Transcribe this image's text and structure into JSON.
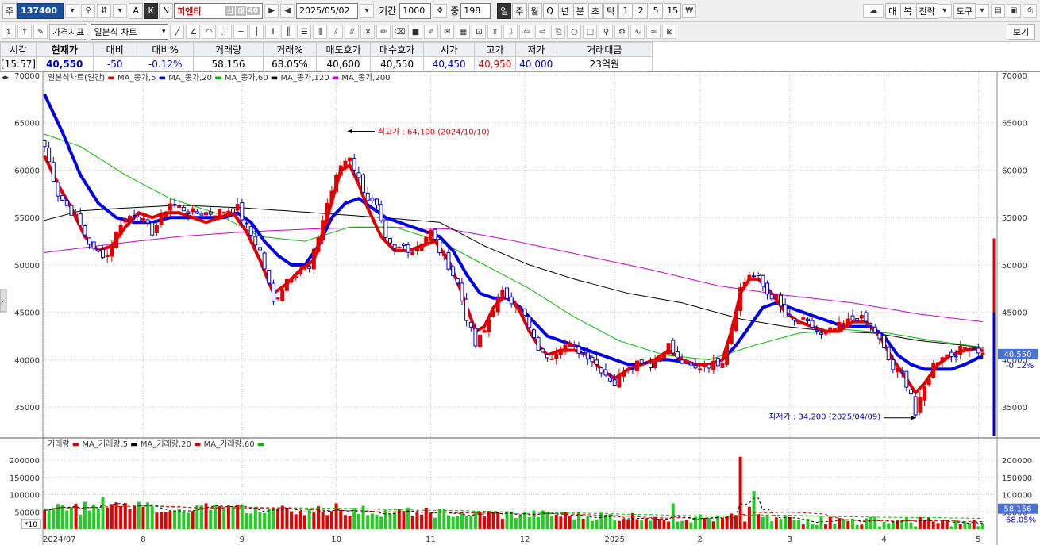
{
  "toolbar1": {
    "market": "주",
    "code": "137400",
    "stock_name": "피엔티",
    "flags": [
      "신",
      "대",
      "40"
    ],
    "date": "2025/05/02",
    "period_label": "기간",
    "period_value": "1000",
    "count_label": "중",
    "count_value": "198",
    "timeframes": [
      "일",
      "주",
      "월",
      "Q",
      "년",
      "분",
      "초",
      "틱",
      "1",
      "2",
      "5",
      "15"
    ],
    "ab_labels": [
      "A",
      "K",
      "N"
    ],
    "right_buttons": [
      "매",
      "복",
      "전략",
      "도구"
    ]
  },
  "toolbar2": {
    "indicator_btn": "가격지표",
    "chart_type": "일본식 차트",
    "view_btn": "보기"
  },
  "quote": {
    "headers": [
      "시각",
      "현재가",
      "대비",
      "대비%",
      "거래량",
      "거래%",
      "매도호가",
      "매수호가",
      "시가",
      "고가",
      "저가",
      "거래대금"
    ],
    "values": [
      "[15:57]",
      "40,550",
      "-50",
      "-0.12%",
      "58,156",
      "68.05%",
      "40,600",
      "40,550",
      "40,450",
      "40,950",
      "40,000",
      "23억원"
    ]
  },
  "chart_data": {
    "type": "candlestick",
    "legend_price": [
      "일본식차트(일간)",
      "MA_종가,5",
      "MA_종가,20",
      "MA_종가,60",
      "MA_종가,120",
      "MA_종가,200"
    ],
    "legend_volume": [
      "거래량",
      "MA_거래량,5",
      "MA_거래량,20",
      "MA_거래량,60"
    ],
    "price_ylim": [
      32000,
      70000
    ],
    "price_ticks": [
      35000,
      40000,
      45000,
      50000,
      55000,
      60000,
      65000,
      70000
    ],
    "volume_ylim": [
      0,
      230000
    ],
    "volume_ticks": [
      50000,
      100000,
      150000,
      200000
    ],
    "x_labels": [
      "2024/07",
      "8",
      "9",
      "10",
      "11",
      "12",
      "2025",
      "2",
      "3",
      "4",
      "5"
    ],
    "x_label_index": [
      0,
      22,
      44,
      65,
      86,
      107,
      127,
      146,
      166,
      187,
      208
    ],
    "high_annotation": "최고가 : 64,100 (2024/10/10)",
    "low_annotation": "최저가 : 34,200 (2025/04/09)",
    "current_price": "40,550",
    "current_change": "-0.12%",
    "current_volume": "58,156",
    "volume_pct": "68.05%",
    "volume_unit": "*10",
    "series_colors": {
      "ma5": "#e00000",
      "ma20": "#0000e0",
      "ma60": "#00bb00",
      "ma120": "#000000",
      "ma200": "#d000d0",
      "up": "#e00000",
      "down": "#0000c8",
      "vol_up": "#e00000",
      "vol_down": "#22cc22"
    },
    "close_anchors": [
      [
        0,
        62500
      ],
      [
        3,
        57500
      ],
      [
        7,
        55000
      ],
      [
        11,
        51500
      ],
      [
        14,
        51000
      ],
      [
        17,
        54500
      ],
      [
        20,
        55500
      ],
      [
        24,
        53500
      ],
      [
        28,
        56500
      ],
      [
        33,
        55500
      ],
      [
        38,
        55500
      ],
      [
        43,
        56000
      ],
      [
        45,
        54000
      ],
      [
        48,
        51500
      ],
      [
        51,
        46000
      ],
      [
        54,
        48500
      ],
      [
        57,
        49500
      ],
      [
        59,
        49500
      ],
      [
        61,
        53000
      ],
      [
        63,
        56500
      ],
      [
        66,
        60500
      ],
      [
        68,
        61500
      ],
      [
        70,
        59000
      ],
      [
        72,
        57000
      ],
      [
        74,
        56000
      ],
      [
        76,
        52500
      ],
      [
        78,
        51500
      ],
      [
        80,
        52000
      ],
      [
        82,
        51500
      ],
      [
        84,
        52500
      ],
      [
        86,
        53500
      ],
      [
        88,
        51500
      ],
      [
        90,
        50000
      ],
      [
        92,
        48000
      ],
      [
        94,
        44500
      ],
      [
        96,
        41500
      ],
      [
        98,
        43000
      ],
      [
        100,
        45500
      ],
      [
        102,
        47000
      ],
      [
        105,
        46000
      ],
      [
        107,
        44500
      ],
      [
        109,
        42000
      ],
      [
        111,
        40500
      ],
      [
        113,
        40500
      ],
      [
        115,
        41500
      ],
      [
        117,
        41500
      ],
      [
        119,
        41000
      ],
      [
        121,
        40500
      ],
      [
        123,
        39500
      ],
      [
        125,
        38500
      ],
      [
        127,
        37500
      ],
      [
        129,
        39000
      ],
      [
        131,
        39500
      ],
      [
        133,
        40000
      ],
      [
        135,
        39500
      ],
      [
        137,
        40500
      ],
      [
        139,
        41500
      ],
      [
        141,
        40000
      ],
      [
        143,
        39500
      ],
      [
        145,
        39000
      ],
      [
        147,
        39500
      ],
      [
        149,
        39500
      ],
      [
        151,
        40000
      ],
      [
        153,
        43500
      ],
      [
        155,
        47500
      ],
      [
        157,
        49000
      ],
      [
        159,
        48500
      ],
      [
        161,
        47000
      ],
      [
        163,
        46500
      ],
      [
        165,
        44500
      ],
      [
        167,
        44000
      ],
      [
        169,
        44000
      ],
      [
        171,
        43500
      ],
      [
        173,
        42500
      ],
      [
        175,
        43000
      ],
      [
        177,
        43500
      ],
      [
        179,
        44000
      ],
      [
        181,
        44500
      ],
      [
        183,
        44000
      ],
      [
        185,
        43000
      ],
      [
        187,
        41000
      ],
      [
        189,
        39000
      ],
      [
        191,
        38500
      ],
      [
        193,
        36500
      ],
      [
        194,
        34200
      ],
      [
        196,
        37000
      ],
      [
        198,
        39500
      ],
      [
        200,
        40500
      ],
      [
        202,
        40500
      ],
      [
        204,
        41000
      ],
      [
        206,
        41500
      ],
      [
        208,
        41000
      ],
      [
        209,
        40550
      ]
    ],
    "ma20_anchors": [
      [
        0,
        68000
      ],
      [
        4,
        64000
      ],
      [
        8,
        59500
      ],
      [
        12,
        56500
      ],
      [
        16,
        55000
      ],
      [
        20,
        54500
      ],
      [
        24,
        54500
      ],
      [
        28,
        55000
      ],
      [
        32,
        55000
      ],
      [
        36,
        55000
      ],
      [
        40,
        55000
      ],
      [
        43,
        55500
      ],
      [
        46,
        54500
      ],
      [
        49,
        52500
      ],
      [
        52,
        51000
      ],
      [
        55,
        50000
      ],
      [
        58,
        50000
      ],
      [
        61,
        52000
      ],
      [
        64,
        55000
      ],
      [
        67,
        56500
      ],
      [
        70,
        57000
      ],
      [
        73,
        56000
      ],
      [
        76,
        55000
      ],
      [
        79,
        54500
      ],
      [
        82,
        54000
      ],
      [
        85,
        53500
      ],
      [
        88,
        53000
      ],
      [
        91,
        51500
      ],
      [
        94,
        49000
      ],
      [
        97,
        47000
      ],
      [
        100,
        46500
      ],
      [
        103,
        46500
      ],
      [
        106,
        45500
      ],
      [
        109,
        44000
      ],
      [
        112,
        42500
      ],
      [
        115,
        42000
      ],
      [
        118,
        41500
      ],
      [
        121,
        41000
      ],
      [
        124,
        40500
      ],
      [
        127,
        40000
      ],
      [
        130,
        39500
      ],
      [
        133,
        39500
      ],
      [
        136,
        40000
      ],
      [
        139,
        40000
      ],
      [
        142,
        39800
      ],
      [
        145,
        39500
      ],
      [
        148,
        39500
      ],
      [
        151,
        40000
      ],
      [
        154,
        41500
      ],
      [
        157,
        43500
      ],
      [
        160,
        45500
      ],
      [
        163,
        46000
      ],
      [
        166,
        45500
      ],
      [
        169,
        45000
      ],
      [
        172,
        44500
      ],
      [
        175,
        44000
      ],
      [
        178,
        43500
      ],
      [
        181,
        43500
      ],
      [
        184,
        43500
      ],
      [
        187,
        42500
      ],
      [
        190,
        40500
      ],
      [
        193,
        39500
      ],
      [
        196,
        39000
      ],
      [
        199,
        39000
      ],
      [
        202,
        39000
      ],
      [
        205,
        39500
      ],
      [
        208,
        40200
      ],
      [
        209,
        40300
      ]
    ],
    "ma5_anchors": [
      [
        0,
        61500
      ],
      [
        3,
        58500
      ],
      [
        6,
        56000
      ],
      [
        9,
        53000
      ],
      [
        12,
        51500
      ],
      [
        15,
        52000
      ],
      [
        18,
        54000
      ],
      [
        21,
        55500
      ],
      [
        24,
        55000
      ],
      [
        27,
        55500
      ],
      [
        30,
        55500
      ],
      [
        33,
        55000
      ],
      [
        36,
        54500
      ],
      [
        39,
        55000
      ],
      [
        42,
        55500
      ],
      [
        45,
        53500
      ],
      [
        48,
        50500
      ],
      [
        51,
        47000
      ],
      [
        54,
        48000
      ],
      [
        57,
        49500
      ],
      [
        60,
        50500
      ],
      [
        63,
        55000
      ],
      [
        66,
        60000
      ],
      [
        68,
        60500
      ],
      [
        70,
        58500
      ],
      [
        72,
        56000
      ],
      [
        75,
        53000
      ],
      [
        78,
        51500
      ],
      [
        81,
        51500
      ],
      [
        84,
        52000
      ],
      [
        87,
        52500
      ],
      [
        90,
        50500
      ],
      [
        93,
        47000
      ],
      [
        96,
        43000
      ],
      [
        98,
        43500
      ],
      [
        100,
        45500
      ],
      [
        102,
        46500
      ],
      [
        104,
        46500
      ],
      [
        106,
        45000
      ],
      [
        108,
        43000
      ],
      [
        110,
        41500
      ],
      [
        112,
        40500
      ],
      [
        115,
        41000
      ],
      [
        118,
        41000
      ],
      [
        121,
        40500
      ],
      [
        124,
        39000
      ],
      [
        127,
        38000
      ],
      [
        130,
        39000
      ],
      [
        133,
        39500
      ],
      [
        136,
        40000
      ],
      [
        139,
        41000
      ],
      [
        142,
        40000
      ],
      [
        145,
        39500
      ],
      [
        148,
        39500
      ],
      [
        151,
        40000
      ],
      [
        153,
        43000
      ],
      [
        155,
        47000
      ],
      [
        157,
        48500
      ],
      [
        159,
        48500
      ],
      [
        162,
        47000
      ],
      [
        165,
        45000
      ],
      [
        168,
        44000
      ],
      [
        171,
        43500
      ],
      [
        174,
        43000
      ],
      [
        177,
        43000
      ],
      [
        180,
        44000
      ],
      [
        183,
        44000
      ],
      [
        186,
        42500
      ],
      [
        189,
        40000
      ],
      [
        192,
        38000
      ],
      [
        194,
        36500
      ],
      [
        196,
        37500
      ],
      [
        199,
        39500
      ],
      [
        202,
        40500
      ],
      [
        205,
        41000
      ],
      [
        208,
        41200
      ],
      [
        209,
        40900
      ]
    ],
    "ma60_anchors": [
      [
        0,
        63800
      ],
      [
        8,
        62500
      ],
      [
        18,
        59500
      ],
      [
        28,
        57000
      ],
      [
        38,
        55500
      ],
      [
        48,
        53000
      ],
      [
        58,
        52500
      ],
      [
        68,
        54000
      ],
      [
        78,
        54000
      ],
      [
        88,
        52500
      ],
      [
        98,
        50000
      ],
      [
        108,
        47500
      ],
      [
        118,
        44500
      ],
      [
        128,
        42000
      ],
      [
        138,
        40500
      ],
      [
        148,
        40000
      ],
      [
        158,
        41500
      ],
      [
        168,
        42800
      ],
      [
        178,
        43200
      ],
      [
        188,
        42800
      ],
      [
        198,
        42000
      ],
      [
        209,
        41300
      ]
    ],
    "ma120_anchors": [
      [
        0,
        54700
      ],
      [
        8,
        55700
      ],
      [
        18,
        56000
      ],
      [
        30,
        56300
      ],
      [
        45,
        56000
      ],
      [
        60,
        55500
      ],
      [
        75,
        55000
      ],
      [
        88,
        54500
      ],
      [
        98,
        52000
      ],
      [
        108,
        50000
      ],
      [
        118,
        48500
      ],
      [
        130,
        47000
      ],
      [
        142,
        46000
      ],
      [
        155,
        44300
      ],
      [
        165,
        43500
      ],
      [
        175,
        43000
      ],
      [
        185,
        42800
      ],
      [
        195,
        42000
      ],
      [
        209,
        41300
      ]
    ],
    "ma200_anchors": [
      [
        0,
        51300
      ],
      [
        15,
        52200
      ],
      [
        30,
        53000
      ],
      [
        45,
        53500
      ],
      [
        60,
        53800
      ],
      [
        75,
        54000
      ],
      [
        90,
        53800
      ],
      [
        105,
        52500
      ],
      [
        120,
        51000
      ],
      [
        135,
        49500
      ],
      [
        150,
        47800
      ],
      [
        165,
        46800
      ],
      [
        180,
        46000
      ],
      [
        195,
        44800
      ],
      [
        209,
        44000
      ]
    ],
    "volume_spikes": [
      [
        0,
        55000
      ],
      [
        2,
        62000
      ],
      [
        3,
        73000
      ],
      [
        8,
        42000
      ],
      [
        13,
        93000
      ],
      [
        22,
        65000
      ],
      [
        25,
        48000
      ],
      [
        28,
        52000
      ],
      [
        30,
        60000
      ],
      [
        33,
        52000
      ],
      [
        36,
        75000
      ],
      [
        40,
        58000
      ],
      [
        46,
        45000
      ],
      [
        54,
        62000
      ],
      [
        60,
        48000
      ],
      [
        62,
        50000
      ],
      [
        65,
        75000
      ],
      [
        71,
        68000
      ],
      [
        78,
        48000
      ],
      [
        84,
        42000
      ],
      [
        90,
        40000
      ],
      [
        95,
        38000
      ],
      [
        102,
        30000
      ],
      [
        110,
        35000
      ],
      [
        120,
        30000
      ],
      [
        127,
        25000
      ],
      [
        133,
        25000
      ],
      [
        137,
        30000
      ],
      [
        140,
        75000
      ],
      [
        145,
        35000
      ],
      [
        150,
        40000
      ],
      [
        153,
        45000
      ],
      [
        155,
        210000
      ],
      [
        157,
        65000
      ],
      [
        158,
        110000
      ],
      [
        160,
        35000
      ],
      [
        165,
        40000
      ],
      [
        170,
        30000
      ],
      [
        175,
        35000
      ],
      [
        180,
        30000
      ],
      [
        185,
        35000
      ],
      [
        190,
        25000
      ],
      [
        195,
        35000
      ],
      [
        200,
        25000
      ],
      [
        205,
        20000
      ]
    ]
  }
}
